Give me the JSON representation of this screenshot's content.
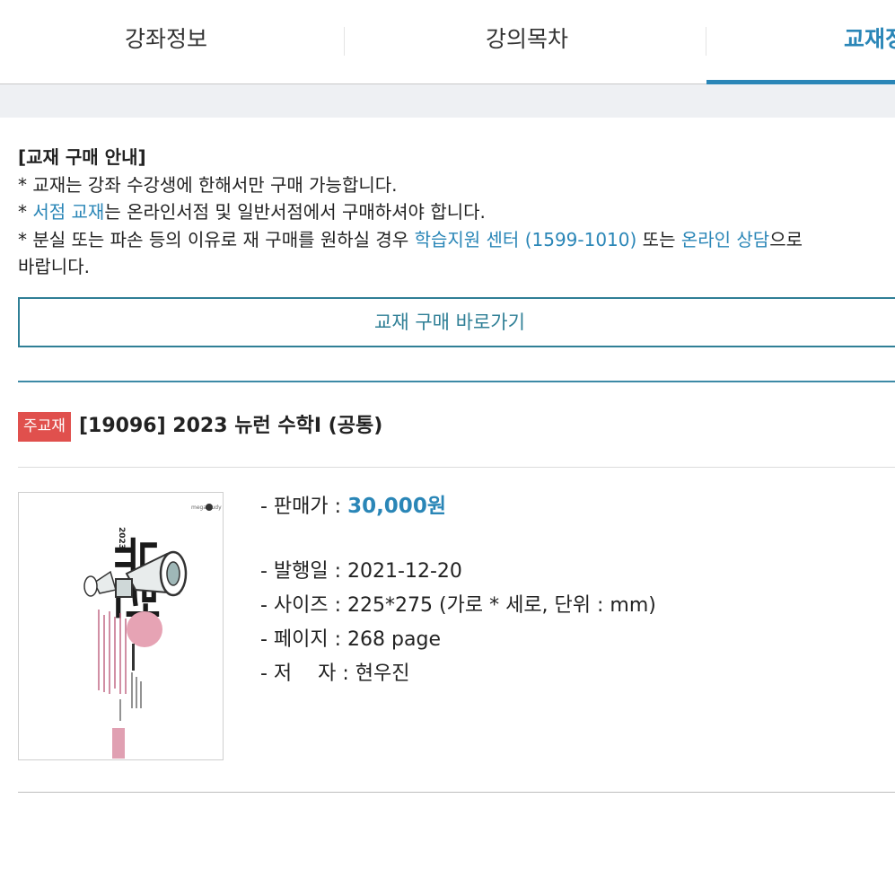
{
  "tabs": [
    {
      "label": "강좌정보",
      "active": false
    },
    {
      "label": "강의목차",
      "active": false
    },
    {
      "label": "교재정",
      "active": true
    }
  ],
  "notice": {
    "title": "[교재 구매 안내]",
    "line1": "* 교재는 강좌 수강생에 한해서만 구매 가능합니다.",
    "line2_prefix": "* ",
    "line2_link": "서점 교재",
    "line2_suffix": "는 온라인서점 및 일반서점에서 구매하셔야 합니다.",
    "line3_prefix": "* 분실 또는 파손 등의 이유로 재 구매를 원하실 경우 ",
    "line3_link1": "학습지원 센터 (1599-1010)",
    "line3_mid": " 또는 ",
    "line3_link2": "온라인 상담",
    "line3_suffix": "으로",
    "line4": "바랍니다."
  },
  "buy_button": {
    "label": "교재 구매 바로가기"
  },
  "book": {
    "badge": "주교재",
    "title": "[19096] 2023 뉴런 수학Ⅰ (공통)",
    "price_label": "- 판매가 : ",
    "price": "30,000원",
    "details": [
      "- 발행일 : 2021-12-20",
      "- 사이즈 : 225*275 (가로 * 세로, 단위 : mm)",
      "- 페이지 : 268 page",
      "- 저　 자 : 현우진"
    ],
    "cover_year": "2023",
    "cover_title": "뉴런",
    "cover_publisher": "megastudy"
  },
  "colors": {
    "accent": "#2a86b7",
    "badge": "#e0504d",
    "button_border": "#2f7f96"
  }
}
